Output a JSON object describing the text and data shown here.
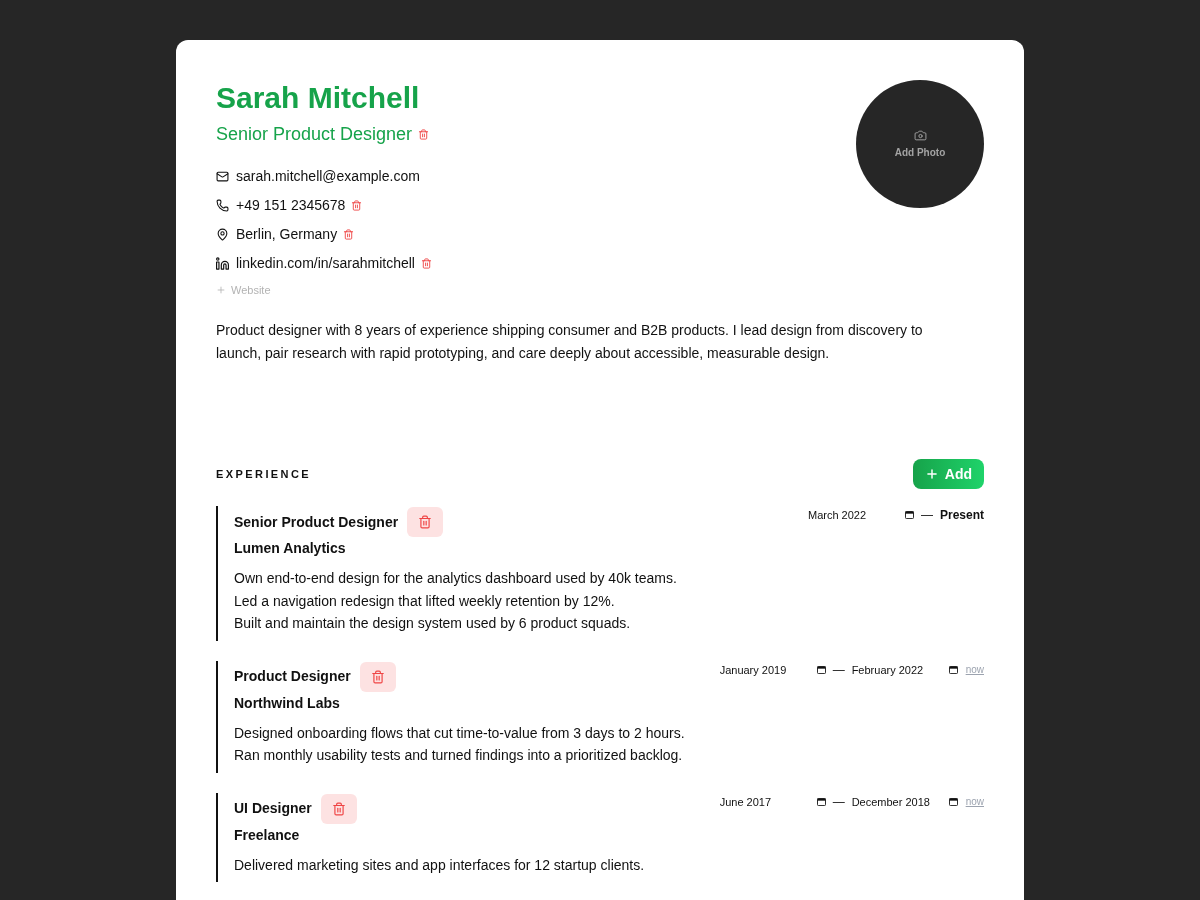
{
  "profile": {
    "name": "Sarah Mitchell",
    "title": "Senior Product Designer",
    "title_removable": true,
    "photo_label": "Add Photo"
  },
  "contacts": [
    {
      "kind": "email",
      "value": "sarah.mitchell@example.com",
      "removable": false
    },
    {
      "kind": "phone",
      "value": "+49 151 2345678",
      "removable": true
    },
    {
      "kind": "location",
      "value": "Berlin, Germany",
      "removable": true
    },
    {
      "kind": "linkedin",
      "value": "linkedin.com/in/sarahmitchell",
      "removable": true
    }
  ],
  "add_fields": [
    {
      "label": "Website"
    }
  ],
  "summary": "Product designer with 8 years of experience shipping consumer and B2B products. I lead design from discovery to launch, pair research with rapid prototyping, and care deeply about accessible, measurable design.",
  "experience": {
    "heading": "EXPERIENCE",
    "add_label": "Add",
    "items": [
      {
        "title": "Senior Product Designer",
        "company": "Lumen Analytics",
        "start": "March 2022",
        "separator": "—",
        "end": {
          "kind": "present",
          "label": "Present"
        },
        "bullets": [
          "Own end-to-end design for the analytics dashboard used by 40k teams.",
          "Led a navigation redesign that lifted weekly retention by 12%.",
          "Built and maintain the design system used by 6 product squads."
        ]
      },
      {
        "title": "Product Designer",
        "company": "Northwind Labs",
        "start": "January 2019",
        "separator": "—",
        "end": {
          "kind": "date",
          "value": "February 2022",
          "link": "now"
        },
        "bullets": [
          "Designed onboarding flows that cut time-to-value from 3 days to 2 hours.",
          "Ran monthly usability tests and turned findings into a prioritized backlog."
        ]
      },
      {
        "title": "UI Designer",
        "company": "Freelance",
        "start": "June 2017",
        "separator": "—",
        "end": {
          "kind": "date",
          "value": "December 2018",
          "link": "now"
        },
        "bullets": [
          "Delivered marketing sites and app interfaces for 12 startup clients."
        ]
      }
    ]
  }
}
